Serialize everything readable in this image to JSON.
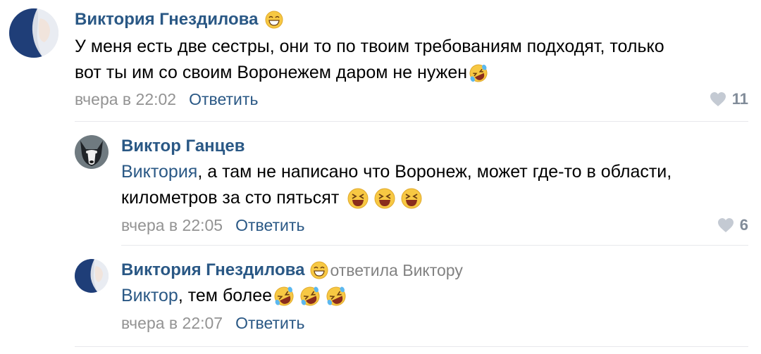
{
  "comments": [
    {
      "author": "Виктория Гнездилова",
      "author_emoji": "grinning-face-with-smiling-eyes-emoji",
      "text_line1": "У меня есть две сестры, они то по твоим требованиям подходят, только",
      "text_line2": "вот ты им со своим Воронежем даром не нужен",
      "text_emoji": "rolling-on-floor-laughing-emoji",
      "time": "вчера в 22:02",
      "reply_label": "Ответить",
      "likes": "11"
    },
    {
      "author": "Виктор Ганцев",
      "mention": "Виктория",
      "text_line1": ", а там не написано что Воронеж, может где-то в области,",
      "text_line2": "километров за сто пятьсят",
      "text_emoji": "grinning-squinting-face-emoji",
      "time": "вчера в 22:05",
      "reply_label": "Ответить",
      "likes": "6"
    },
    {
      "author": "Виктория Гнездилова",
      "author_emoji": "grinning-face-with-smiling-eyes-emoji",
      "replied_to": "ответила Виктору",
      "mention": "Виктор",
      "text": ", тем более",
      "text_emoji": "rolling-on-floor-laughing-emoji",
      "time": "вчера в 22:07",
      "reply_label": "Ответить"
    }
  ],
  "colors": {
    "link": "#2a5885",
    "meta": "#939393",
    "likes": "#818c99",
    "divider": "#e7e8ec"
  }
}
